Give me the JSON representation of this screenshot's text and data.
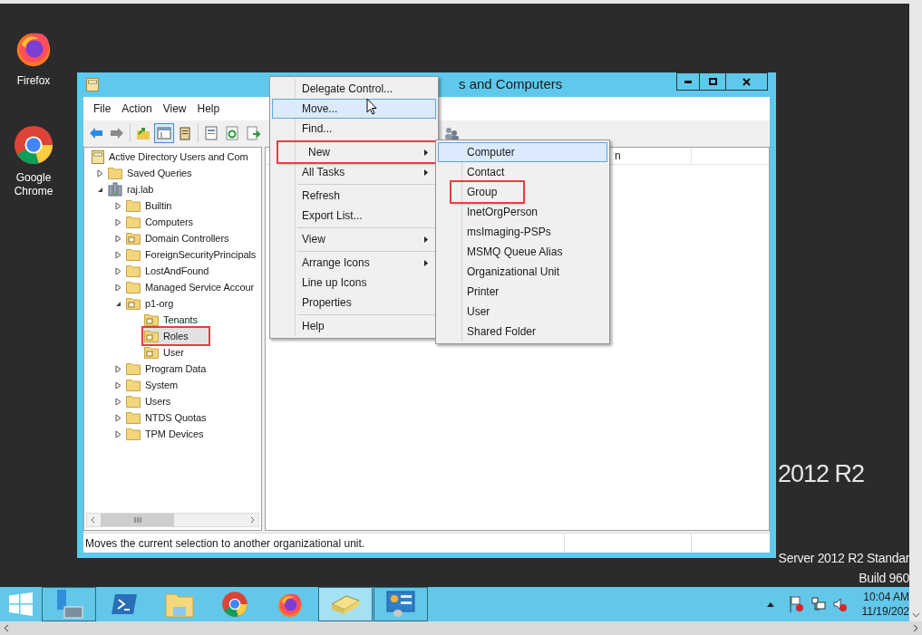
{
  "desktop": {
    "icons": [
      {
        "label": "Firefox",
        "kind": "firefox"
      },
      {
        "label": "Google Chrome",
        "kind": "chrome"
      }
    ],
    "edition": "2012 R2",
    "build_lines": [
      "Server 2012 R2 Standar",
      "Build 960"
    ]
  },
  "window": {
    "title": "s and Computers",
    "menu": [
      "File",
      "Action",
      "View",
      "Help"
    ],
    "tree": {
      "label": "Active Directory Users and Com",
      "kind": "root",
      "selected": false,
      "children": [
        {
          "label": "Saved Queries",
          "kind": "folder",
          "expanded": false,
          "selected": false
        },
        {
          "label": "raj.lab",
          "kind": "domain",
          "expanded": true,
          "selected": false,
          "children": [
            {
              "label": "Builtin",
              "kind": "folder",
              "expanded": false,
              "selected": false
            },
            {
              "label": "Computers",
              "kind": "folder",
              "expanded": false,
              "selected": false
            },
            {
              "label": "Domain Controllers",
              "kind": "ou",
              "expanded": false,
              "selected": false
            },
            {
              "label": "ForeignSecurityPrincipals",
              "kind": "folder",
              "expanded": false,
              "selected": false
            },
            {
              "label": "LostAndFound",
              "kind": "folder",
              "expanded": false,
              "selected": false
            },
            {
              "label": "Managed Service Accour",
              "kind": "folder",
              "expanded": false,
              "selected": false
            },
            {
              "label": "p1-org",
              "kind": "ou",
              "expanded": true,
              "selected": false,
              "children": [
                {
                  "label": "Tenants",
                  "kind": "ou",
                  "selected": false,
                  "annotated": false
                },
                {
                  "label": "Roles",
                  "kind": "ou",
                  "selected": true,
                  "annotated": true
                },
                {
                  "label": "User",
                  "kind": "ou",
                  "selected": false,
                  "annotated": false
                }
              ]
            },
            {
              "label": "Program Data",
              "kind": "folder",
              "expanded": false,
              "selected": false
            },
            {
              "label": "System",
              "kind": "folder",
              "expanded": false,
              "selected": false
            },
            {
              "label": "Users",
              "kind": "folder",
              "expanded": false,
              "selected": false
            },
            {
              "label": "NTDS Quotas",
              "kind": "folder",
              "expanded": false,
              "selected": false
            },
            {
              "label": "TPM Devices",
              "kind": "folder",
              "expanded": false,
              "selected": false
            }
          ]
        }
      ]
    },
    "list_header": [
      "n"
    ],
    "status_bar": "Moves the current selection to another organizational unit."
  },
  "context_menu": {
    "items": [
      {
        "kind": "item",
        "label": "Delegate Control...",
        "highlighted": false,
        "annotated": false,
        "has_submenu": false
      },
      {
        "kind": "item",
        "label": "Move...",
        "highlighted": true,
        "annotated": false,
        "has_submenu": false
      },
      {
        "kind": "item",
        "label": "Find...",
        "highlighted": false,
        "annotated": false,
        "has_submenu": false
      },
      {
        "kind": "separator"
      },
      {
        "kind": "item",
        "label": "New",
        "highlighted": false,
        "annotated": true,
        "has_submenu": true
      },
      {
        "kind": "item",
        "label": "All Tasks",
        "highlighted": false,
        "annotated": false,
        "has_submenu": true
      },
      {
        "kind": "separator"
      },
      {
        "kind": "item",
        "label": "Refresh",
        "highlighted": false,
        "annotated": false,
        "has_submenu": false
      },
      {
        "kind": "item",
        "label": "Export List...",
        "highlighted": false,
        "annotated": false,
        "has_submenu": false
      },
      {
        "kind": "separator"
      },
      {
        "kind": "item",
        "label": "View",
        "highlighted": false,
        "annotated": false,
        "has_submenu": true
      },
      {
        "kind": "separator"
      },
      {
        "kind": "item",
        "label": "Arrange Icons",
        "highlighted": false,
        "annotated": false,
        "has_submenu": true
      },
      {
        "kind": "item",
        "label": "Line up Icons",
        "highlighted": false,
        "annotated": false,
        "has_submenu": false
      },
      {
        "kind": "item",
        "label": "Properties",
        "highlighted": false,
        "annotated": false,
        "has_submenu": false
      },
      {
        "kind": "separator"
      },
      {
        "kind": "item",
        "label": "Help",
        "highlighted": false,
        "annotated": false,
        "has_submenu": false
      }
    ]
  },
  "submenu": {
    "items": [
      {
        "label": "Computer",
        "highlighted": true,
        "annotated": false
      },
      {
        "label": "Contact",
        "highlighted": false,
        "annotated": false
      },
      {
        "label": "Group",
        "highlighted": false,
        "annotated": true
      },
      {
        "label": "InetOrgPerson",
        "highlighted": false,
        "annotated": false
      },
      {
        "label": "msImaging-PSPs",
        "highlighted": false,
        "annotated": false
      },
      {
        "label": "MSMQ Queue Alias",
        "highlighted": false,
        "annotated": false
      },
      {
        "label": "Organizational Unit",
        "highlighted": false,
        "annotated": false
      },
      {
        "label": "Printer",
        "highlighted": false,
        "annotated": false
      },
      {
        "label": "User",
        "highlighted": false,
        "annotated": false
      },
      {
        "label": "Shared Folder",
        "highlighted": false,
        "annotated": false
      }
    ]
  },
  "taskbar": {
    "buttons": [
      {
        "kind": "server_manager",
        "running": true,
        "active": false
      },
      {
        "kind": "powershell",
        "running": false,
        "active": false
      },
      {
        "kind": "explorer",
        "running": false,
        "active": false
      },
      {
        "kind": "chrome",
        "running": false,
        "active": false
      },
      {
        "kind": "firefox",
        "running": false,
        "active": false
      },
      {
        "kind": "aduc",
        "running": true,
        "active": true
      },
      {
        "kind": "control",
        "running": true,
        "active": false
      }
    ],
    "clock": {
      "time": "10:04 AM",
      "date": "11/19/202"
    }
  }
}
